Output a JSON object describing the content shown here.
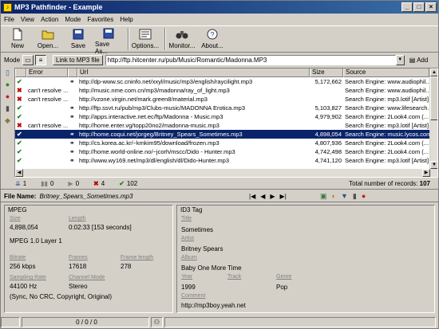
{
  "window": {
    "title": "MP3 Pathfinder - Example",
    "minimize": "_",
    "maximize": "□",
    "close": "×"
  },
  "menu": [
    "File",
    "View",
    "Action",
    "Mode",
    "Favorites",
    "Help"
  ],
  "toolbar": [
    "New",
    "Open...",
    "Save",
    "Save As...",
    "Options...",
    "Monitor...",
    "About..."
  ],
  "modebar": {
    "mode_label": "Mode",
    "link_label": "Link to MP3 file",
    "url": "http://ftp.hitcenter.ru/pub/Music/Romantic/Madonna.MP3",
    "add_label": "Add"
  },
  "grid": {
    "headers": [
      "Error",
      "Url",
      "Size",
      "Source"
    ],
    "selected_index": 6,
    "rows": [
      {
        "status": "ok",
        "error": "",
        "url": "http://dp-www.sc.cninfo.net/xxyl/music/mp3/english/raycilight.mp3",
        "size": "5,172,662",
        "source": "Search Engine: www.audiophil..."
      },
      {
        "status": "err",
        "error": "can't resolve ...",
        "url": "http://music.nme.com.cn/mp3/madonna/ray_of_light.mp3",
        "size": "",
        "source": "Search Engine: www.audiophil..."
      },
      {
        "status": "err",
        "error": "can't resolve ...",
        "url": "http://vzone.virgin.net/mark.green8/material.mp3",
        "size": "",
        "source": "Search Engine: mp3.lotif [Artist]"
      },
      {
        "status": "ok",
        "error": "",
        "url": "http://ftp.ssvt.ru/pub/mp3/Clubs-music/MADONNA Erotica.mp3",
        "size": "5,103,827",
        "source": "Search Engine: www.lifesearch..."
      },
      {
        "status": "ok",
        "error": "",
        "url": "http://apps.interactive.net.ec/ftp/Madonna - Music.mp3",
        "size": "4,979,902",
        "source": "Search Engine: 2Look4.com (..."
      },
      {
        "status": "err",
        "error": "can't resolve ...",
        "url": "http://home.enter.vg/topp20no2/madonna-music.mp3",
        "size": "",
        "source": "Search Engine: mp3.lotif [Artist]"
      },
      {
        "status": "ok",
        "error": "",
        "url": "http://home.coqui.net/jorgeg/Britney_Spears_Sometimes.mp3",
        "size": "4,898,054",
        "source": "Search Engine: music.lycos.com"
      },
      {
        "status": "ok",
        "error": "",
        "url": "http://cs.korea.ac.kr/~kmkim95/download/frozen.mp3",
        "size": "4,807,936",
        "source": "Search Engine: 2Look4.com (..."
      },
      {
        "status": "ok",
        "error": "",
        "url": "http://home.world-online.no/~jcorh/mscc/Dido - Hunter.mp3",
        "size": "4,742,498",
        "source": "Search Engine: 2Look4.com (..."
      },
      {
        "status": "ok",
        "error": "",
        "url": "http://www.wy169.net/mp3/dl/english/dl/Dido-Hunter.mp3",
        "size": "4,741,120",
        "source": "Search Engine: mp3.lotif [Artist]"
      }
    ]
  },
  "stats": {
    "a": "1",
    "b": "0",
    "c": "0",
    "d": "4",
    "e": "102",
    "total_label": "Total number of records:",
    "total": "107"
  },
  "file": {
    "label": "File Name:",
    "name": "Britney_Spears_Sometimes.mp3"
  },
  "mpeg": {
    "title": "MPEG",
    "size_label": "Size",
    "size": "4,898,054",
    "length_label": "Length",
    "length": "0:02:33 [153 seconds]",
    "version": "MPEG 1.0 Layer 1",
    "bitrate_label": "Bitrate",
    "bitrate": "256 kbps",
    "frames_label": "Frames",
    "frames": "17618",
    "frame_length_label": "Frame length",
    "frame_length": "278",
    "sampling_label": "Sampling Rate",
    "sampling": "44100 Hz",
    "channel_label": "Channel Mode",
    "channel": "Stereo",
    "flags": "(Sync, No CRC, Copyright, Original)"
  },
  "id3": {
    "title": "ID3 Tag",
    "song_label": "Title",
    "song": "Sometimes",
    "artist_label": "Artist",
    "artist": "Britney Spears",
    "album_label": "Album",
    "album": "Baby One More Time",
    "year_label": "Year",
    "year": "1999",
    "track_label": "Track",
    "track": "",
    "genre_label": "Genre",
    "genre": "Pop",
    "comment_label": "Comment",
    "comment": "http://mp3boy.yeah.net"
  },
  "status": {
    "counts": "0 / 0 / 0"
  }
}
